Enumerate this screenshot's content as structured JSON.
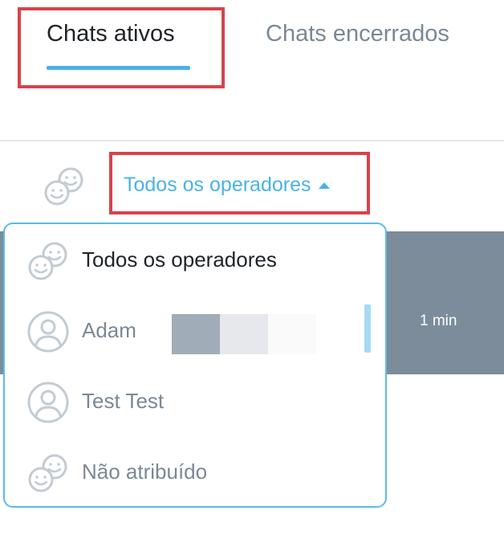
{
  "tabs": {
    "active_label": "Chats ativos",
    "inactive_label": "Chats encerrados"
  },
  "filter": {
    "selected_label": "Todos os operadores",
    "icon": "operators-icon"
  },
  "chat_row": {
    "time": "1 min"
  },
  "dropdown": {
    "options": [
      {
        "label": "Todos os operadores",
        "icon": "operators-icon"
      },
      {
        "label": "Adam",
        "icon": "user-avatar-icon"
      },
      {
        "label": "Test Test",
        "icon": "user-avatar-icon"
      },
      {
        "label": "Não atribuído",
        "icon": "operators-icon"
      }
    ]
  },
  "colors": {
    "accent": "#4ab2e8",
    "highlight": "#d9424a",
    "row_background": "#7c8c9b",
    "muted_text": "#7b8895"
  }
}
